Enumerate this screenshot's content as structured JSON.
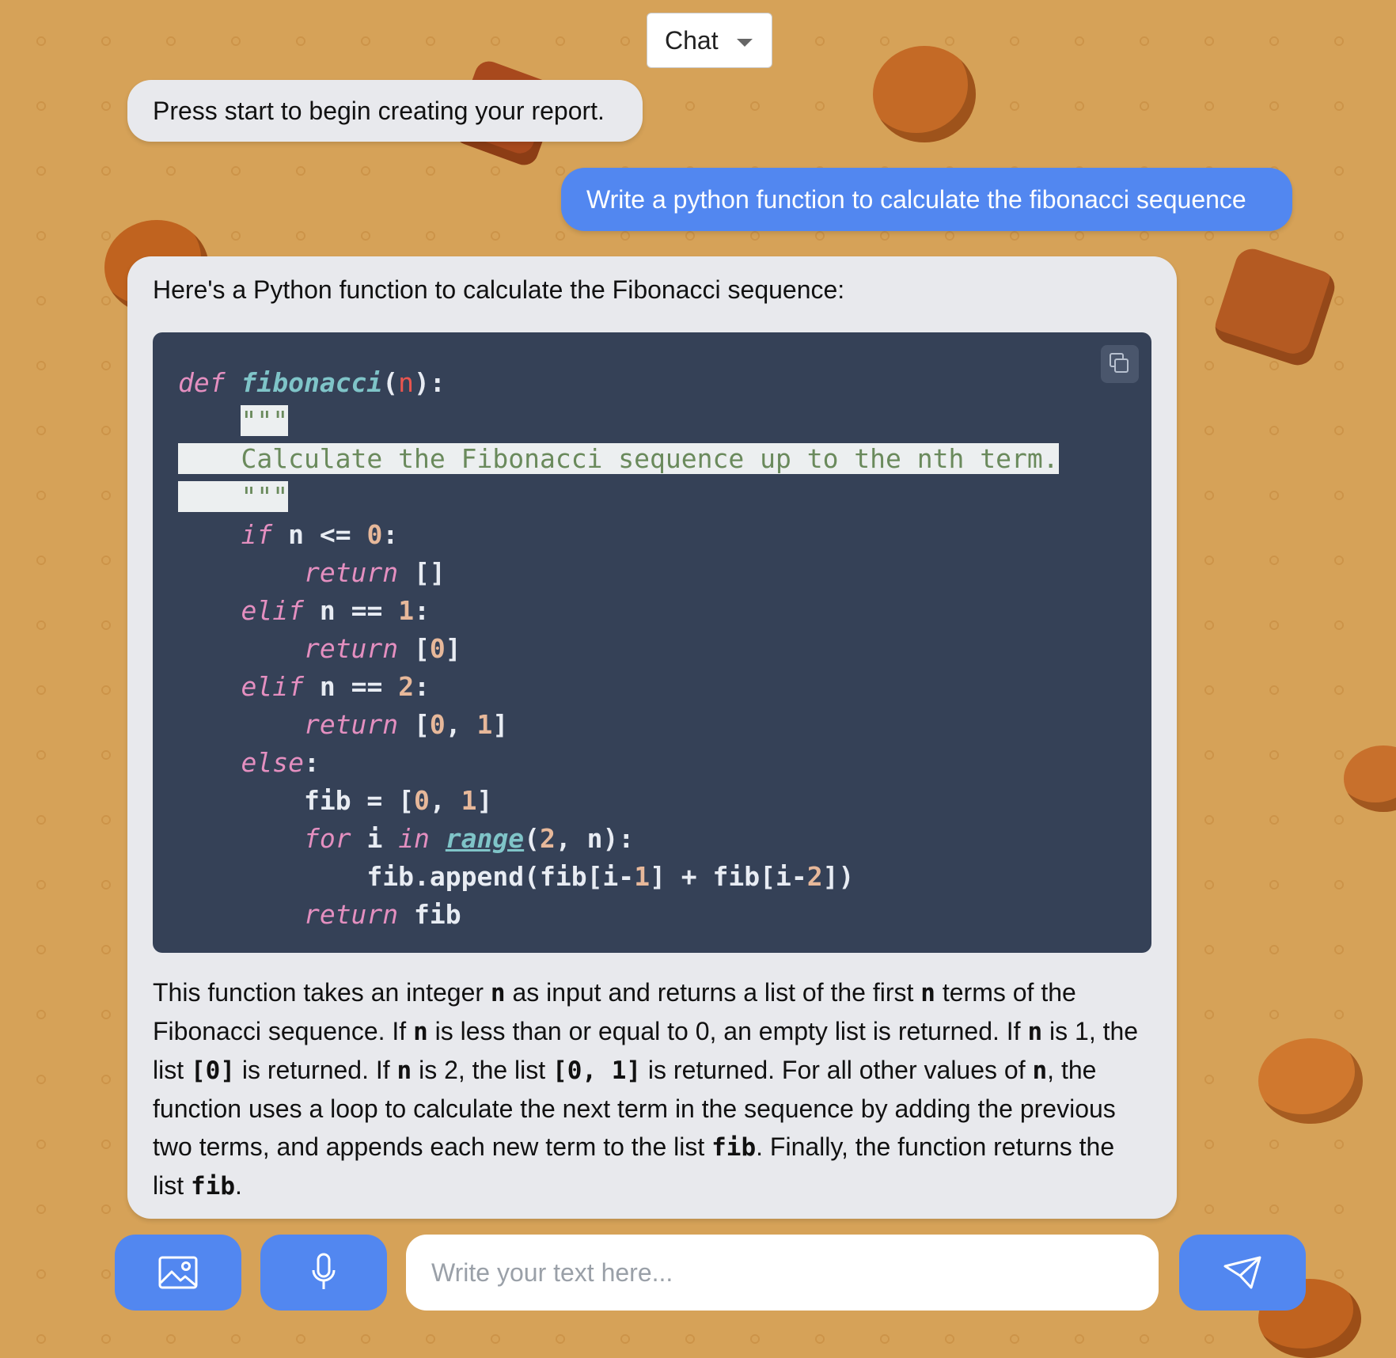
{
  "mode": {
    "selected": "Chat"
  },
  "messages": {
    "bot_intro": "Press start to begin creating your report.",
    "user": "Write a python function to calculate the fibonacci sequence",
    "answer_intro": "Here's a Python function to calculate the Fibonacci sequence:"
  },
  "code": {
    "language": "python",
    "lines": [
      "def fibonacci(n):",
      "    \"\"\"",
      "    Calculate the Fibonacci sequence up to the nth term.",
      "    \"\"\"",
      "    if n <= 0:",
      "        return []",
      "    elif n == 1:",
      "        return [0]",
      "    elif n == 2:",
      "        return [0, 1]",
      "    else:",
      "        fib = [0, 1]",
      "        for i in range(2, n):",
      "            fib.append(fib[i-1] + fib[i-2])",
      "        return fib"
    ],
    "copy_icon": "copy-icon"
  },
  "answer_body": {
    "p1": "This function takes an integer ",
    "c1": "n",
    "p2": " as input and returns a list of the first ",
    "c2": "n",
    "p3": " terms of the Fibonacci sequence. If ",
    "c3": "n",
    "p4": " is less than or equal to 0, an empty list is returned. If ",
    "c4": "n",
    "p5": " is 1, the list ",
    "c5": "[0]",
    "p6": " is returned. If ",
    "c6": "n",
    "p7": " is 2, the list ",
    "c7": "[0, 1]",
    "p8": " is returned. For all other values of ",
    "c8": "n",
    "p9": ", the function uses a loop to calculate the next term in the sequence by adding the previous two terms, and appends each new term to the list ",
    "c9": "fib",
    "p10": ". Finally, the function returns the list ",
    "c10": "fib",
    "p11": "."
  },
  "composer": {
    "placeholder": "Write your text here...",
    "image_icon": "image-icon",
    "mic_icon": "microphone-icon",
    "send_icon": "send-icon"
  },
  "colors": {
    "background": "#d6a258",
    "accent": "#5287f0",
    "bubble": "#e8e9ed",
    "code_bg": "#354157"
  }
}
